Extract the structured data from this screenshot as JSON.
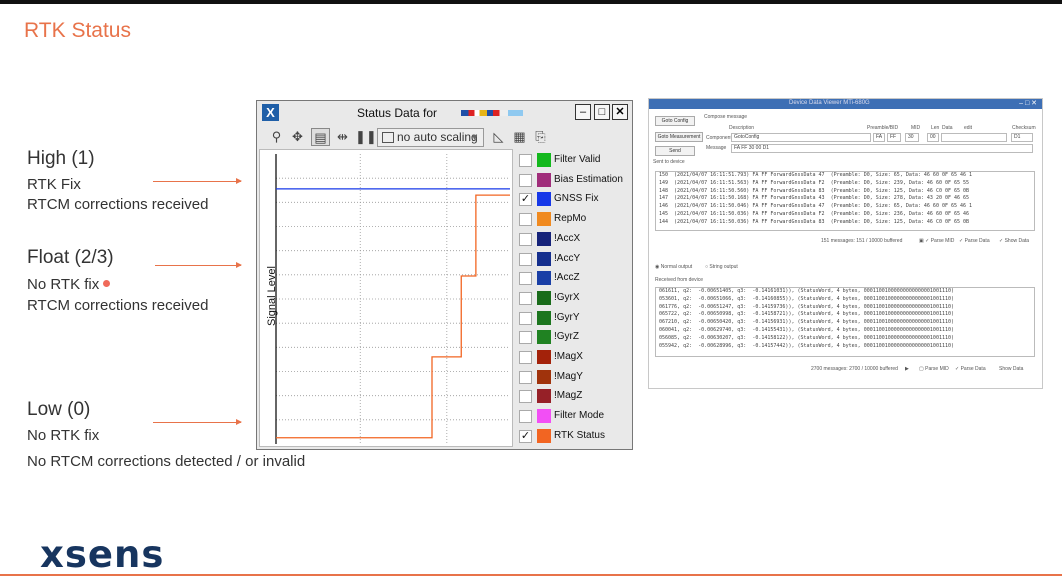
{
  "slide": {
    "title": "RTK Status",
    "levels": [
      {
        "heading": "High (1)",
        "lines": [
          "RTK Fix",
          "RTCM corrections received"
        ]
      },
      {
        "heading": "Float (2/3)",
        "lines": [
          "No RTK fix",
          "RTCM corrections received"
        ]
      },
      {
        "heading": "Low (0)",
        "lines": [
          "No RTK fix",
          "No RTCM corrections detected / or invalid"
        ]
      }
    ],
    "logo": "xsens"
  },
  "status_window": {
    "title": "Status Data for",
    "scaling": "no auto scaling",
    "y_axis_label": "Signal Level",
    "legend": [
      {
        "label": "Filter Valid",
        "color": "#13b81d",
        "checked": false
      },
      {
        "label": "Bias Estimation",
        "color": "#a02d7a",
        "checked": false
      },
      {
        "label": "GNSS Fix",
        "color": "#1738e8",
        "checked": true
      },
      {
        "label": "RepMo",
        "color": "#f08a20",
        "checked": false
      },
      {
        "label": "!AccX",
        "color": "#16237a",
        "checked": false
      },
      {
        "label": "!AccY",
        "color": "#152f8e",
        "checked": false
      },
      {
        "label": "!AccZ",
        "color": "#1a3fa6",
        "checked": false
      },
      {
        "label": "!GyrX",
        "color": "#196b1a",
        "checked": false
      },
      {
        "label": "!GyrY",
        "color": "#1c751e",
        "checked": false
      },
      {
        "label": "!GyrZ",
        "color": "#208222",
        "checked": false
      },
      {
        "label": "!MagX",
        "color": "#a3220a",
        "checked": false
      },
      {
        "label": "!MagY",
        "color": "#a0330c",
        "checked": false
      },
      {
        "label": "!MagZ",
        "color": "#962027",
        "checked": false
      },
      {
        "label": "Filter Mode",
        "color": "#f24ff5",
        "checked": false
      },
      {
        "label": "RTK Status",
        "color": "#f26522",
        "checked": true
      }
    ]
  },
  "chart_data": {
    "type": "line",
    "ylabel": "Signal Level",
    "series": [
      {
        "name": "GNSS Fix",
        "color": "#1738e8",
        "x": [
          0,
          240
        ],
        "y": [
          4,
          4
        ]
      },
      {
        "name": "RTK Status",
        "color": "#f26522",
        "x": [
          0,
          160,
          160,
          190,
          190,
          205,
          205,
          240
        ],
        "y": [
          0,
          0,
          1.3,
          1.3,
          2.6,
          2.6,
          3.9,
          3.9
        ]
      }
    ]
  },
  "device_window": {
    "title": "Device Data Viewer MTi-680G",
    "buttons": [
      "Goto Config",
      "Goto Measurement",
      "Send"
    ],
    "compose_label": "Compose message",
    "description_label": "Description",
    "preamble_label": "Preamble/BID",
    "mid_label": "MID",
    "len_label": "Len",
    "data_label": "Data",
    "checksum_label": "Checksum",
    "component_label": "Component",
    "component_value": "GotoConfig",
    "preamble_value": "FA",
    "bid_value": "FF",
    "mid_value": "30",
    "len_value": "00",
    "edit_label": "edit",
    "checksum_value": "D1",
    "message_label": "Message",
    "message_value": "FA FF 30 00 D1",
    "sent_label": "Sent to device",
    "sent_lines": [
      "150  (2021/04/07 16:11:51.793) FA FF ForwardGnssData 47  (Preamble: D0, Size: 65, Data: 46 60 0F 65 46 1",
      "149  (2021/04/07 16:11:51.563) FA FF ForwardGnssData F2  (Preamble: D0, Size: 239, Data: 46 60 0F 65 55",
      "148  (2021/04/07 16:11:50.560) FA FF ForwardGnssData 83  (Preamble: D0, Size: 125, Data: 46 C0 0F 65 0B",
      "147  (2021/04/07 16:11:50.168) FA FF ForwardGnssData 43  (Preamble: D0, Size: 278, Data: 43 20 0F 46 65",
      "146  (2021/04/07 16:11:50.046) FA FF ForwardGnssData 47  (Preamble: D0, Size: 65, Data: 46 60 0F 65 46 1",
      "145  (2021/04/07 16:11:50.036) FA FF ForwardGnssData F2  (Preamble: D0, Size: 236, Data: 46 60 0F 65 46",
      "144  (2021/04/07 16:11:50.036) FA FF ForwardGnssData 83  (Preamble: D0, Size: 125, Data: 46 C0 0F 65 0B"
    ],
    "sent_status": "151 messages: 151 / 10000 buffered",
    "parse_mid": "Parse MID",
    "parse_data": "Parse Data",
    "show_data": "Show Data",
    "normal_output": "Normal output",
    "string_output": "String output",
    "received_label": "Received from device",
    "recv_lines": [
      "061611, q2:  -0.00651405, q3:  -0.14161031)), (StatusWord, 4 bytes, 00011001000000000000001001110)",
      "053601, q2:  -0.00651066, q3:  -0.14160855)), (StatusWord, 4 bytes, 00011001000000000000001001110)",
      "061776, q2:  -0.00651247, q3:  -0.14159736)), (StatusWord, 4 bytes, 00011001000000000000001001110)",
      "065722, q2:  -0.00650998, q3:  -0.14158721)), (StatusWord, 4 bytes, 00011001000000000000001001110)",
      "067210, q2:  -0.00650420, q3:  -0.14156931)), (StatusWord, 4 bytes, 00011001000000000000001001110)",
      "060041, q2:  -0.00629740, q3:  -0.14155431)), (StatusWord, 4 bytes, 00011001000000000000001001110)",
      "056085, q2:  -0.00630207, q3:  -0.14158122)), (StatusWord, 4 bytes, 00011001000000000000001001110)",
      "055942, q2:  -0.00628996, q3:  -0.14157442)), (StatusWord, 4 bytes, 00011001000000000000001001110)"
    ],
    "recv_status": "2700 messages: 2700 / 10000 buffered"
  }
}
